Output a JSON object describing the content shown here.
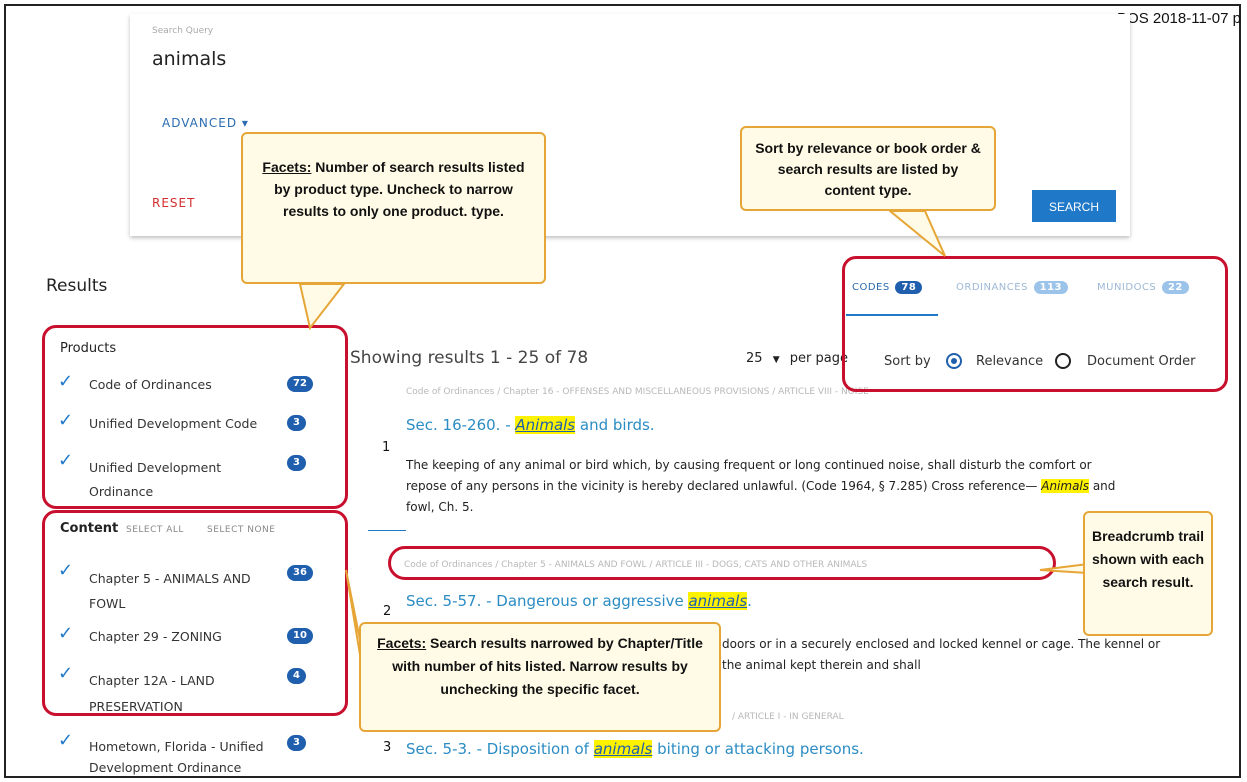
{
  "doc_id": "BOS 2018-11-07 p",
  "search": {
    "label": "Search Query",
    "query": "animals",
    "advanced": "ADVANCED ▾",
    "reset": "RESET",
    "search_button": "SEARCH"
  },
  "results_title": "Results",
  "callouts": {
    "facets_top_title": "Facets:",
    "facets_top_text": " Number of search results listed by product type. Uncheck to narrow results to only one product. type.",
    "sort": "Sort by relevance or book order & search results are listed by content type.",
    "facets_bottom_title": "Facets:",
    "facets_bottom_text": " Search results narrowed by Chapter/Title with number of hits listed. Narrow results by unchecking the specific facet.",
    "breadcrumb": "Breadcrumb trail shown with each search result."
  },
  "products": {
    "title": "Products",
    "items": [
      {
        "label": "Code of Ordinances",
        "count": "72"
      },
      {
        "label": "Unified Development Code",
        "count": "3"
      },
      {
        "label": "Unified Development Ordinance",
        "count": "3"
      }
    ]
  },
  "content": {
    "title": "Content",
    "select_all": "SELECT ALL",
    "select_none": "SELECT NONE",
    "items": [
      {
        "label": "Chapter 5 - ANIMALS AND FOWL",
        "count": "36"
      },
      {
        "label": "Chapter 29 - ZONING",
        "count": "10"
      },
      {
        "label": "Chapter 12A - LAND PRESERVATION",
        "count": "4"
      },
      {
        "label": "Hometown, Florida - Unified Development Ordinance",
        "count": "3"
      }
    ]
  },
  "tabs": [
    {
      "label": "CODES",
      "count": "78"
    },
    {
      "label": "ORDINANCES",
      "count": "113"
    },
    {
      "label": "MUNIDOCS",
      "count": "22"
    }
  ],
  "showing": "Showing results 1 - 25 of 78",
  "per_page_value": "25",
  "per_page_label": "per page",
  "sort_by_label": "Sort by",
  "sort_options": [
    "Relevance",
    "Document Order"
  ],
  "results": [
    {
      "num": "1",
      "crumb": "Code of Ordinances / Chapter 16 - OFFENSES AND MISCELLANEOUS PROVISIONS / ARTICLE VIII - NOISE",
      "title_pre": "Sec. 16-260. - ",
      "title_hl": "Animals",
      "title_post": " and birds.",
      "snippet_1": "The keeping of any animal or bird which, by causing frequent or long continued noise, shall disturb the comfort or",
      "snippet_2_pre": "repose of any persons in the vicinity is hereby declared unlawful. (Code 1964, § 7.285) Cross reference— ",
      "snippet_2_hl": "Animals",
      "snippet_2_post": " and",
      "snippet_3": "fowl, Ch. 5."
    },
    {
      "num": "2",
      "crumb": "Code of Ordinances / Chapter 5 - ANIMALS AND FOWL / ARTICLE III - DOGS, CATS AND OTHER ANIMALS",
      "title_pre": "Sec. 5-57. - Dangerous or aggressive ",
      "title_hl": "animals",
      "title_post": ".",
      "snippet_1": "doors or in a securely enclosed and locked kennel or cage. The kennel or",
      "snippet_2": "the animal kept therein and shall"
    },
    {
      "num": "3",
      "crumb": "/ ARTICLE I - IN GENERAL",
      "title_pre": "Sec. 5-3. - Disposition of ",
      "title_hl": "animals",
      "title_post": " biting or attacking persons."
    }
  ]
}
